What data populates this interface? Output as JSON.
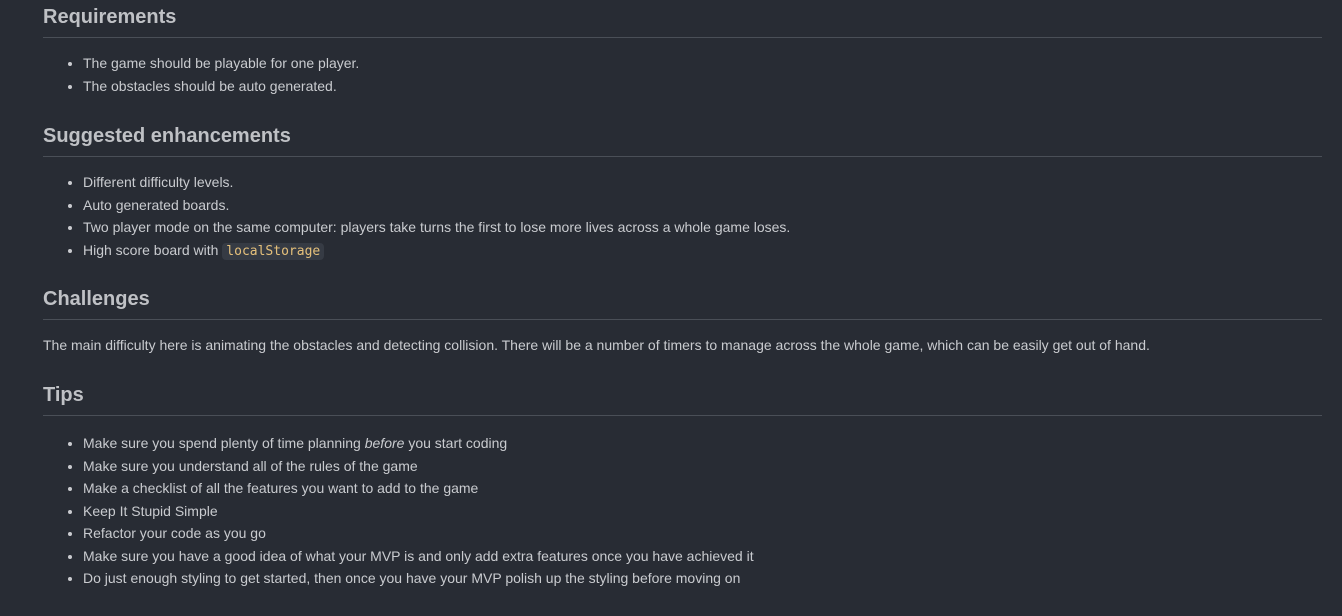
{
  "requirements": {
    "title": "Requirements",
    "items": [
      "The game should be playable for one player.",
      "The obstacles should be auto generated."
    ]
  },
  "enhancements": {
    "title": "Suggested enhancements",
    "items": [
      "Different difficulty levels.",
      "Auto generated boards.",
      "Two player mode on the same computer: players take turns the first to lose more lives across a whole game loses.",
      "High score board with "
    ],
    "code": "localStorage"
  },
  "challenges": {
    "title": "Challenges",
    "text": "The main difficulty here is animating the obstacles and detecting collision. There will be a number of timers to manage across the whole game, which can be easily get out of hand."
  },
  "tips": {
    "title": "Tips",
    "first_pre": "Make sure you spend plenty of time planning ",
    "first_em": "before",
    "first_post": " you start coding",
    "items": [
      "Make sure you understand all of the rules of the game",
      "Make a checklist of all the features you want to add to the game",
      "Keep It Stupid Simple",
      "Refactor your code as you go",
      "Make sure you have a good idea of what your MVP is and only add extra features once you have achieved it",
      "Do just enough styling to get started, then once you have your MVP polish up the styling before moving on"
    ]
  }
}
